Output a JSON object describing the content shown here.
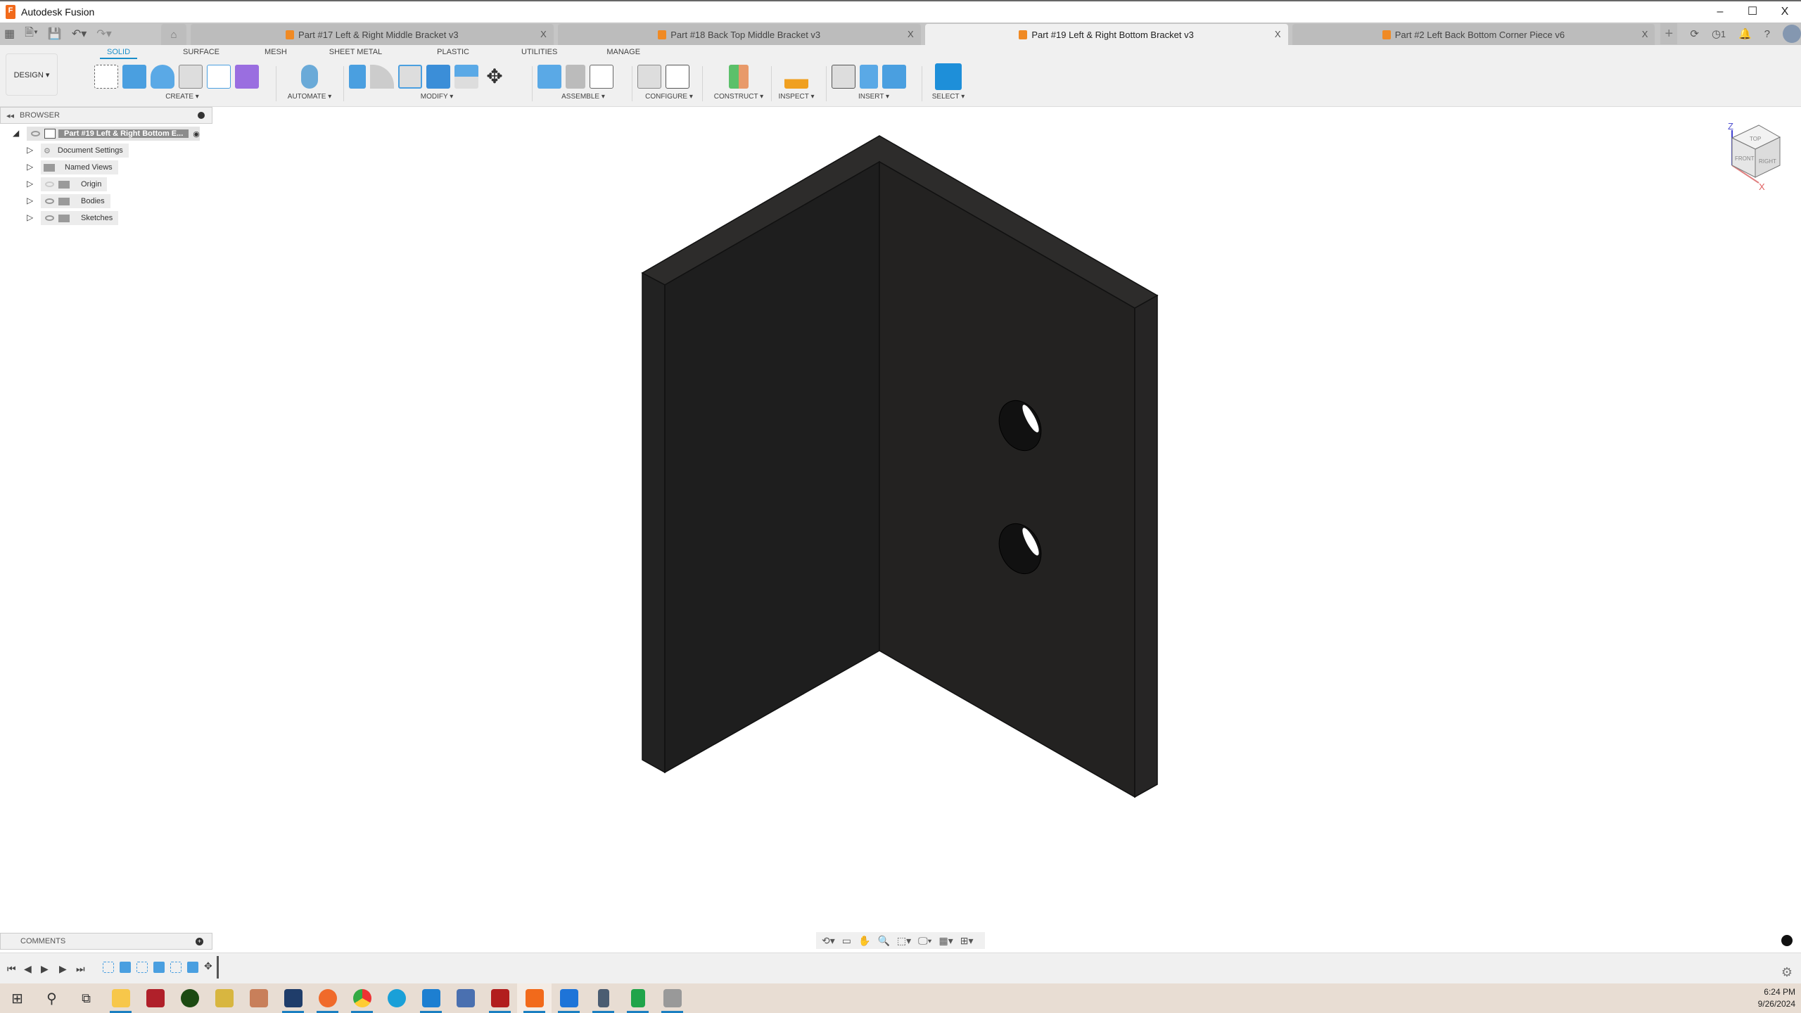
{
  "app": {
    "title": "Autodesk Fusion",
    "logo_letter": "F"
  },
  "window_controls": {
    "minimize": "–",
    "maximize": "☐",
    "close": "X"
  },
  "quick_access": {
    "grid": "▦",
    "file": "🗎▾",
    "save": "💾",
    "undo": "↶▾",
    "redo": "↷▾"
  },
  "tabs": [
    {
      "label": "Part #17 Left & Right Middle Bracket v3",
      "active": false,
      "close": "X"
    },
    {
      "label": "Part #18 Back Top Middle Bracket v3",
      "active": false,
      "close": "X"
    },
    {
      "label": "Part #19 Left & Right Bottom Bracket v3",
      "active": true,
      "close": "X"
    },
    {
      "label": "Part #2 Left Back Bottom Corner Piece v6",
      "active": false,
      "close": "X"
    }
  ],
  "tab_right": {
    "new_tab": "+",
    "job_count": "1"
  },
  "ribbon": {
    "workspace": "DESIGN ▾",
    "tabs": [
      "SOLID",
      "SURFACE",
      "MESH",
      "SHEET METAL",
      "PLASTIC",
      "UTILITIES",
      "MANAGE"
    ],
    "active_tab": "SOLID",
    "groups": [
      {
        "label": "CREATE ▾"
      },
      {
        "label": "AUTOMATE ▾"
      },
      {
        "label": "MODIFY ▾"
      },
      {
        "label": "ASSEMBLE ▾"
      },
      {
        "label": "CONFIGURE ▾"
      },
      {
        "label": "CONSTRUCT ▾"
      },
      {
        "label": "INSPECT ▾"
      },
      {
        "label": "INSERT ▾"
      },
      {
        "label": "SELECT ▾"
      }
    ]
  },
  "browser": {
    "title": "BROWSER",
    "root": "Part #19 Left & Right Bottom E...",
    "items": [
      {
        "label": "Document Settings"
      },
      {
        "label": "Named Views"
      },
      {
        "label": "Origin"
      },
      {
        "label": "Bodies"
      },
      {
        "label": "Sketches"
      }
    ]
  },
  "viewcube": {
    "top": "TOP",
    "front": "FRONT",
    "right": "RIGHT",
    "z": "Z",
    "x": "X"
  },
  "comments": {
    "title": "COMMENTS",
    "add": "+"
  },
  "timeline": {
    "controls": [
      "⏮",
      "◀",
      "▶",
      "▶",
      "⏭"
    ]
  },
  "taskbar": {
    "apps": [
      "start",
      "search",
      "task-view",
      "file-explorer",
      "es",
      "ss",
      "app-blue",
      "app-game",
      "virtualbox",
      "firefox",
      "chrome",
      "edge",
      "vscode",
      "network",
      "filezilla",
      "fusion",
      "app-c",
      "calculator",
      "sheets",
      "gimp"
    ],
    "time": "6:24 PM",
    "date": "9/26/2024"
  }
}
